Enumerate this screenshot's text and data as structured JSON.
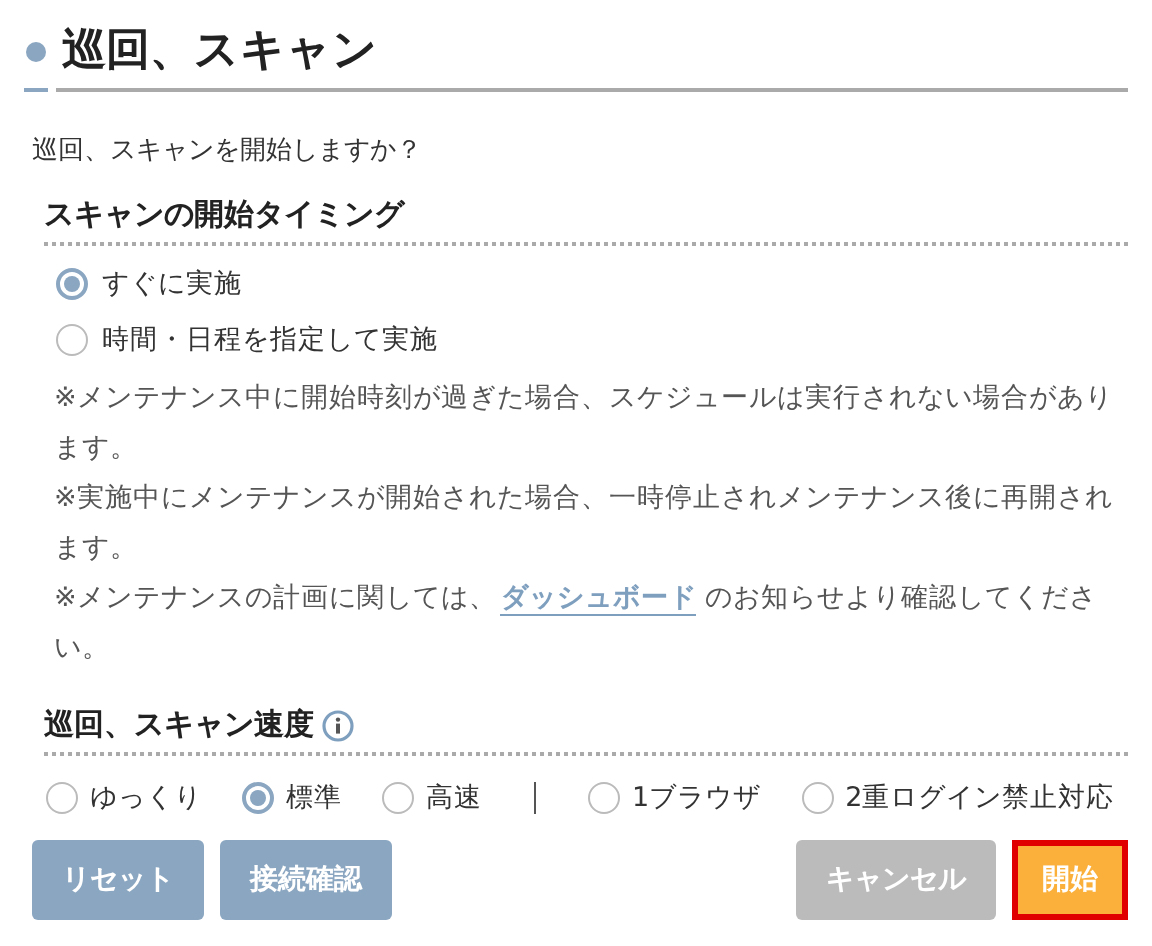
{
  "title": "巡回、スキャン",
  "question": "巡回、スキャンを開始しますか？",
  "timing": {
    "heading": "スキャンの開始タイミング",
    "options": [
      {
        "label": "すぐに実施",
        "selected": true
      },
      {
        "label": "時間・日程を指定して実施",
        "selected": false
      }
    ],
    "notes": [
      {
        "text": "※メンテナンス中に開始時刻が過ぎた場合、スケジュールは実行されない場合があります。"
      },
      {
        "text": "※実施中にメンテナンスが開始された場合、一時停止されメンテナンス後に再開されます。"
      },
      {
        "text": "※メンテナンスの計画に関しては、",
        "link": "ダッシュボード",
        "after": "のお知らせより確認してください。"
      }
    ]
  },
  "speed": {
    "heading": "巡回、スキャン速度",
    "options": [
      {
        "label": "ゆっくり",
        "selected": false
      },
      {
        "label": "標準",
        "selected": true
      },
      {
        "label": "高速",
        "selected": false
      }
    ],
    "extra_options": [
      {
        "label": "1ブラウザ",
        "selected": false
      },
      {
        "label": "2重ログイン禁止対応",
        "selected": false
      }
    ]
  },
  "buttons": [
    {
      "label": "リセット",
      "kind": "secondary",
      "focused": false
    },
    {
      "label": "接続確認",
      "kind": "secondary",
      "focused": false
    },
    {
      "label": "キャンセル",
      "kind": "cancel",
      "focused": false
    },
    {
      "label": "開始",
      "kind": "primary",
      "focused": true
    }
  ]
}
